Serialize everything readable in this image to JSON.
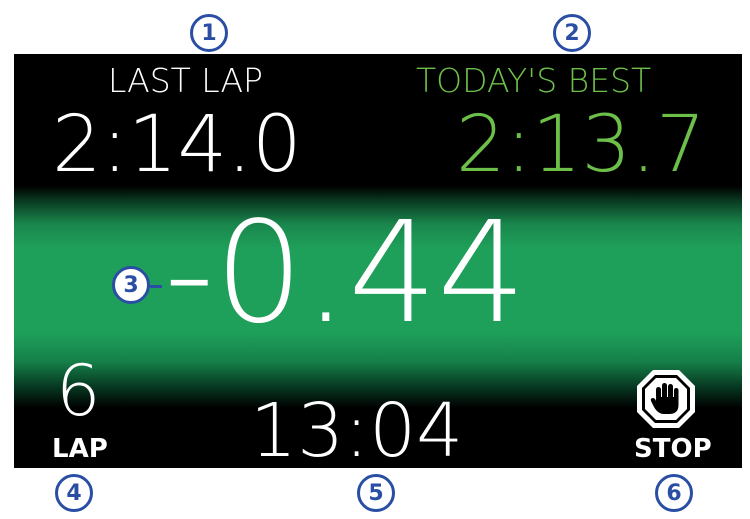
{
  "display": {
    "last_lap_label": "LAST LAP",
    "last_lap_time": "2:14.0",
    "todays_best_label": "TODAY'S BEST",
    "todays_best_time": "2:13.7",
    "delta": "-0.44",
    "lap_number": "6",
    "lap_label": "LAP",
    "elapsed_time": "13:04",
    "stop_label": "STOP"
  },
  "callouts": [
    "1",
    "2",
    "3",
    "4",
    "5",
    "6"
  ],
  "colors": {
    "accent_green": "#1fa05a",
    "best_text_green": "#6cc04a",
    "callout_blue": "#2a4ea3",
    "background": "#000000"
  },
  "icons": {
    "stop": "stop-hand-icon"
  }
}
